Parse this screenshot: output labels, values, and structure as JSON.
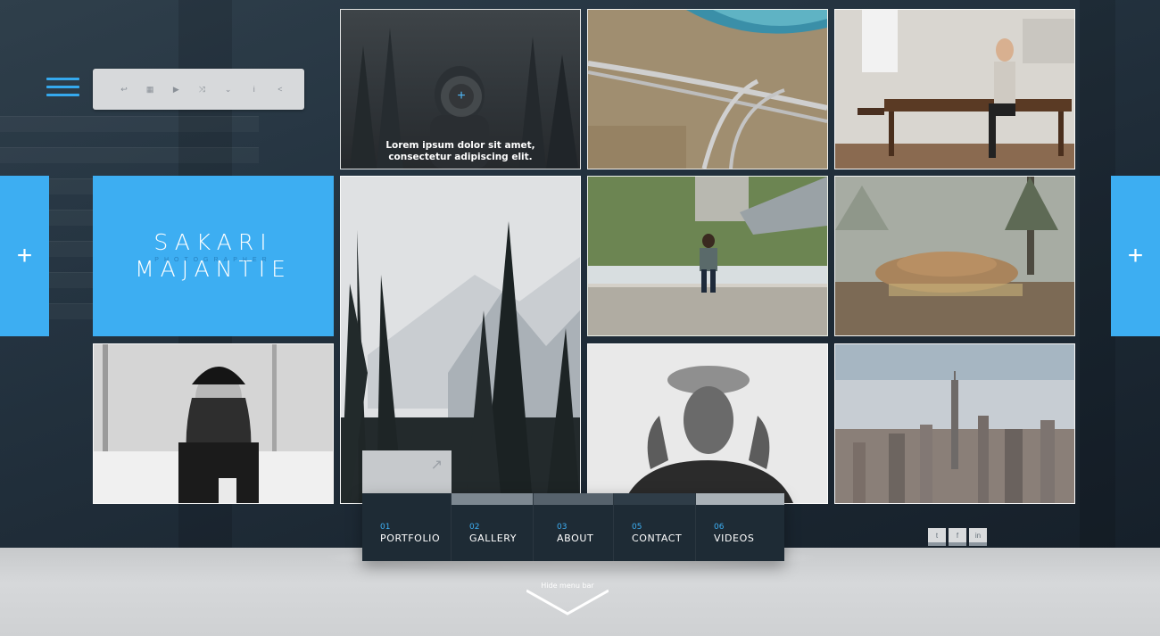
{
  "toolbar": {
    "icons": [
      "back-icon",
      "grid-icon",
      "play-icon",
      "shuffle-icon",
      "chevrons-down-icon",
      "info-icon",
      "share-icon"
    ],
    "glyphs": [
      "↩",
      "▦",
      "▶",
      "⤨",
      "⌄",
      "i",
      "<"
    ]
  },
  "brand": {
    "line1": "SAKARI",
    "line2": "MAJANTIE",
    "tagline": "PHOTOGRAPHER"
  },
  "side_buttons": {
    "left": "+",
    "right": "+"
  },
  "featured": {
    "plus": "+",
    "caption_line1": "Lorem ipsum dolor sit amet,",
    "caption_line2": "consectetur adipiscing elit."
  },
  "nav": {
    "items": [
      {
        "num": "01",
        "label": "PORTFOLIO"
      },
      {
        "num": "02",
        "label": "GALLERY"
      },
      {
        "num": "03",
        "label": "ABOUT"
      },
      {
        "num": "05",
        "label": "CONTACT"
      },
      {
        "num": "06",
        "label": "VIDEOS"
      }
    ],
    "active_arrow": "↗"
  },
  "social": {
    "twitter": "t",
    "facebook": "f",
    "linkedin": "in"
  },
  "hide_menu": "Hide menu bar",
  "colors": {
    "accent": "#3daef2",
    "nav_bg": "#1e2b35",
    "page_bg": "#1c2833"
  }
}
